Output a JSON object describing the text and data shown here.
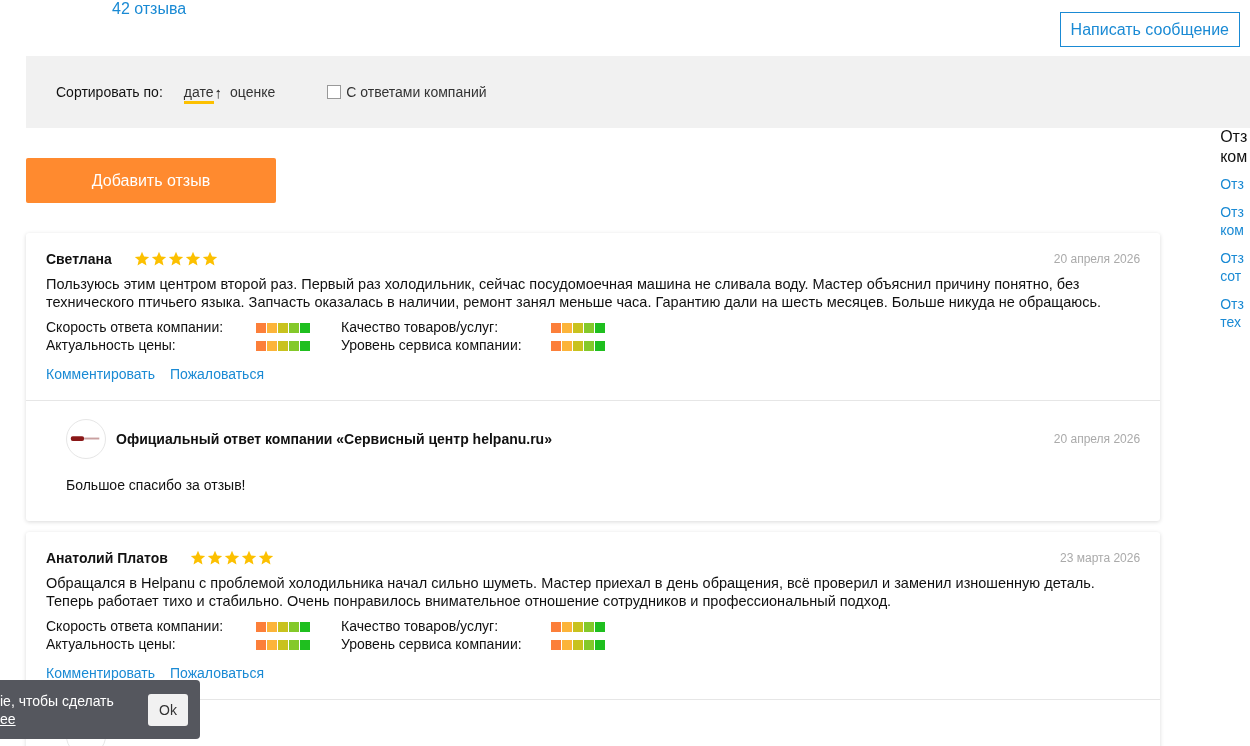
{
  "reviews_count": "42 отзыва",
  "message_button": "Написать сообщение",
  "sort": {
    "label": "Сортировать по:",
    "options": [
      {
        "label": "дате",
        "selected": true,
        "arrow": "↑"
      },
      {
        "label": "оценке",
        "selected": false
      }
    ],
    "filter": {
      "label": "С ответами компаний",
      "checked": false
    }
  },
  "add_button": "Добавить отзыв",
  "reviews": [
    {
      "author": "Светлана",
      "stars": 5,
      "date": "20 апреля 2026",
      "text": "Пользуюсь этим центром второй раз. Первый раз холодильник, сейчас посудомоечная машина не сливала воду. Мастер объяснил причину понятно, без технического птичьего языка. Запчасть оказалась в наличии, ремонт занял меньше часа. Гарантию дали на шесть месяцев. Больше никуда не обращаюсь.",
      "criteria": [
        {
          "label": "Скорость ответа компании:",
          "level": 1
        },
        {
          "label": "Качество товаров/услуг:",
          "level": 1
        },
        {
          "label": "Актуальность цены:",
          "level": 1
        },
        {
          "label": "Уровень сервиса компании:",
          "level": 1
        }
      ],
      "actions": [
        "Комментировать",
        "Пожаловаться"
      ],
      "reply": {
        "title": "Официальный ответ компании «Сервисный центр helpanu.ru»",
        "date": "20 апреля 2026",
        "text": "Большое спасибо за отзыв!"
      }
    },
    {
      "author": "Анатолий Платов",
      "stars": 5,
      "date": "23 марта 2026",
      "text": "Обращался в Helpanu с проблемой холодильника начал сильно шуметь. Мастер приехал в день обращения, всё проверил и заменил изношенную деталь. Теперь работает тихо и стабильно. Очень понравилось внимательное отношение сотрудников и профессиональный подход.",
      "criteria": [
        {
          "label": "Скорость ответа компании:",
          "level": 1
        },
        {
          "label": "Качество товаров/услуг:",
          "level": 1
        },
        {
          "label": "Актуальность цены:",
          "level": 1
        },
        {
          "label": "Уровень сервиса компании:",
          "level": 1
        }
      ],
      "actions": [
        "Комментировать",
        "Пожаловаться"
      ],
      "reply": {
        "kind": "cut"
      }
    }
  ],
  "sidebar": {
    "title": [
      "Отз",
      "ком"
    ],
    "links": [
      [
        "Отз"
      ],
      [
        "Отз",
        "ком"
      ],
      [
        "Отз",
        "сот"
      ],
      [
        "Отз",
        "тех"
      ]
    ]
  },
  "cookie": {
    "text": "ie, чтобы сделать",
    "link": "ee",
    "button": "Ok"
  }
}
